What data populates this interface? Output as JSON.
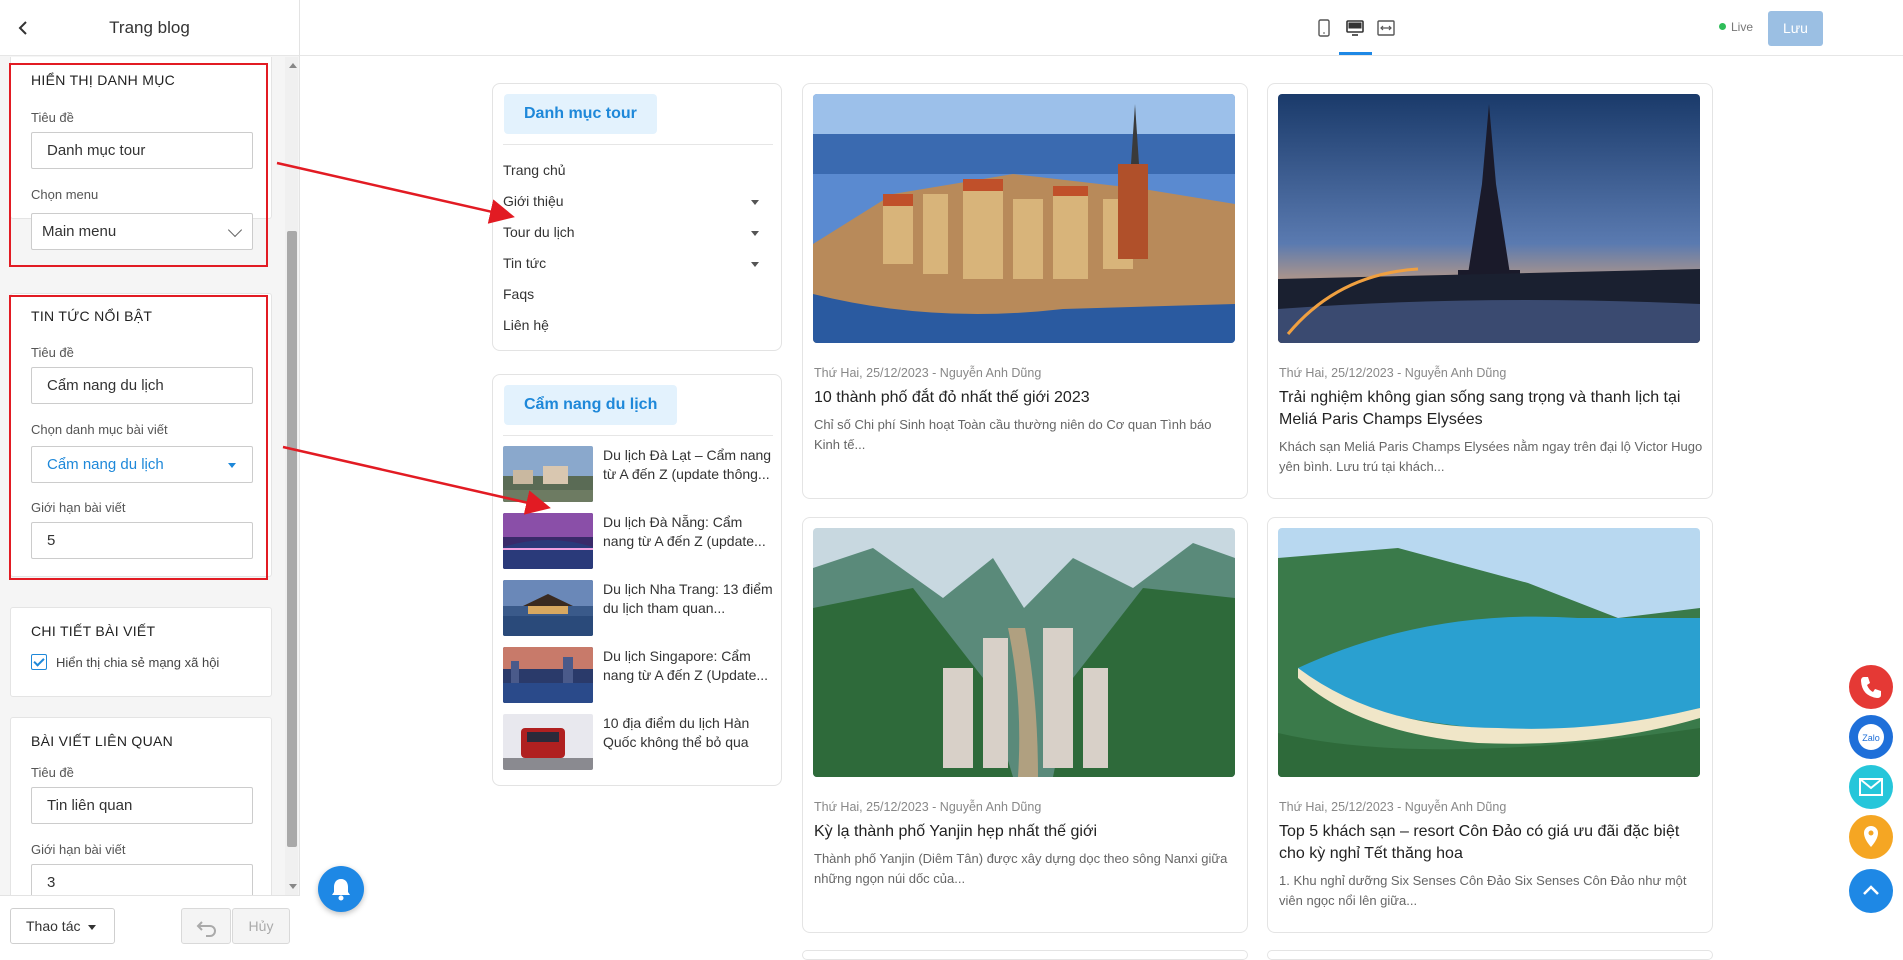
{
  "sidebar": {
    "title": "Trang blog",
    "category_section": {
      "heading": "HIỂN THỊ DANH MỤC",
      "title_label": "Tiêu đề",
      "title_value": "Danh mục tour",
      "menu_label": "Chọn menu",
      "menu_value": "Main menu"
    },
    "featured_section": {
      "heading": "TIN TỨC NỔI BẬT",
      "title_label": "Tiêu đề",
      "title_value": "Cẩm nang du lịch",
      "category_label": "Chọn danh mục bài viết",
      "category_value": "Cẩm nang du lịch",
      "limit_label": "Giới hạn bài viết",
      "limit_value": "5"
    },
    "detail_section": {
      "heading": "CHI TIẾT BÀI VIẾT",
      "share_label": "Hiển thị chia sẻ mạng xã hội",
      "share_checked": true
    },
    "related_section": {
      "heading": "BÀI VIẾT LIÊN QUAN",
      "title_label": "Tiêu đề",
      "title_value": "Tin liên quan",
      "limit_label": "Giới hạn bài viết",
      "limit_value": "3"
    },
    "footer": {
      "actions_label": "Thao tác",
      "cancel_label": "Hủy"
    }
  },
  "topbar": {
    "devices": [
      "mobile-icon",
      "desktop-icon",
      "fullwidth-icon"
    ],
    "active_device": "desktop-icon",
    "live_label": "Live",
    "save_label": "Lưu"
  },
  "preview": {
    "category_box": {
      "title": "Danh mục tour",
      "items": [
        {
          "label": "Trang chủ",
          "has_children": false
        },
        {
          "label": "Giới thiệu",
          "has_children": true
        },
        {
          "label": "Tour du lịch",
          "has_children": true
        },
        {
          "label": "Tin tức",
          "has_children": true
        },
        {
          "label": "Faqs",
          "has_children": false
        },
        {
          "label": "Liên hệ",
          "has_children": false
        }
      ]
    },
    "featured_box": {
      "title": "Cẩm nang du lịch",
      "items": [
        {
          "title": "Du lịch Đà Lạt – Cẩm nang từ A đến Z (update thông..."
        },
        {
          "title": "Du lịch Đà Nẵng: Cẩm nang từ A đến Z (update..."
        },
        {
          "title": "Du lịch Nha Trang: 13 điểm du lịch tham quan..."
        },
        {
          "title": "Du lịch Singapore: Cẩm nang từ A đến Z (Update..."
        },
        {
          "title": "10 địa điểm du lịch Hàn Quốc không thể bỏ qua"
        }
      ]
    },
    "posts": [
      {
        "meta": "Thứ Hai, 25/12/2023 - Nguyễn Anh Dũng",
        "title": "10 thành phố đắt đỏ nhất thế giới 2023",
        "excerpt": "Chỉ số Chi phí Sinh hoạt Toàn cầu thường niên do Cơ quan Tình báo Kinh tế..."
      },
      {
        "meta": "Thứ Hai, 25/12/2023 - Nguyễn Anh Dũng",
        "title": "Trải nghiệm không gian sống sang trọng và thanh lịch tại Meliá Paris Champs Elysées",
        "excerpt": "Khách sạn Meliá Paris Champs Elysées nằm ngay trên đại lộ Victor Hugo yên bình. Lưu trú tại khách..."
      },
      {
        "meta": "Thứ Hai, 25/12/2023 - Nguyễn Anh Dũng",
        "title": "Kỳ lạ thành phố Yanjin hẹp nhất thế giới",
        "excerpt": "Thành phố Yanjin (Diêm Tân) được xây dựng dọc theo sông Nanxi giữa những ngọn núi dốc của..."
      },
      {
        "meta": "Thứ Hai, 25/12/2023 - Nguyễn Anh Dũng",
        "title": "Top 5 khách sạn – resort Côn Đảo có giá ưu đãi đặc biệt cho kỳ nghỉ Tết thăng hoa",
        "excerpt": "1. Khu nghỉ dưỡng Six Senses Côn Đảo Six Senses Côn Đảo như một viên ngọc nổi lên giữa..."
      }
    ]
  },
  "floating": [
    "phone-icon",
    "zalo-icon",
    "mail-icon",
    "location-icon",
    "scroll-top-icon"
  ],
  "colors": {
    "accent": "#1e88e5",
    "highlight": "#e21b23",
    "live": "#2ebd59"
  }
}
